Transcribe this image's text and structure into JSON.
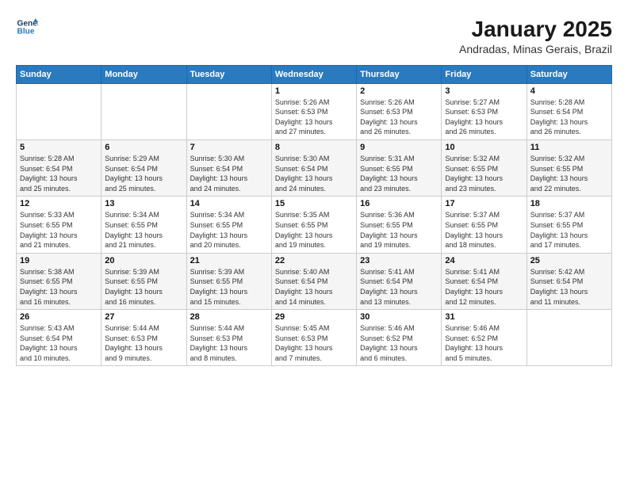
{
  "logo": {
    "line1": "General",
    "line2": "Blue"
  },
  "title": "January 2025",
  "subtitle": "Andradas, Minas Gerais, Brazil",
  "weekdays": [
    "Sunday",
    "Monday",
    "Tuesday",
    "Wednesday",
    "Thursday",
    "Friday",
    "Saturday"
  ],
  "weeks": [
    [
      {
        "day": "",
        "info": ""
      },
      {
        "day": "",
        "info": ""
      },
      {
        "day": "",
        "info": ""
      },
      {
        "day": "1",
        "info": "Sunrise: 5:26 AM\nSunset: 6:53 PM\nDaylight: 13 hours\nand 27 minutes."
      },
      {
        "day": "2",
        "info": "Sunrise: 5:26 AM\nSunset: 6:53 PM\nDaylight: 13 hours\nand 26 minutes."
      },
      {
        "day": "3",
        "info": "Sunrise: 5:27 AM\nSunset: 6:53 PM\nDaylight: 13 hours\nand 26 minutes."
      },
      {
        "day": "4",
        "info": "Sunrise: 5:28 AM\nSunset: 6:54 PM\nDaylight: 13 hours\nand 26 minutes."
      }
    ],
    [
      {
        "day": "5",
        "info": "Sunrise: 5:28 AM\nSunset: 6:54 PM\nDaylight: 13 hours\nand 25 minutes."
      },
      {
        "day": "6",
        "info": "Sunrise: 5:29 AM\nSunset: 6:54 PM\nDaylight: 13 hours\nand 25 minutes."
      },
      {
        "day": "7",
        "info": "Sunrise: 5:30 AM\nSunset: 6:54 PM\nDaylight: 13 hours\nand 24 minutes."
      },
      {
        "day": "8",
        "info": "Sunrise: 5:30 AM\nSunset: 6:54 PM\nDaylight: 13 hours\nand 24 minutes."
      },
      {
        "day": "9",
        "info": "Sunrise: 5:31 AM\nSunset: 6:55 PM\nDaylight: 13 hours\nand 23 minutes."
      },
      {
        "day": "10",
        "info": "Sunrise: 5:32 AM\nSunset: 6:55 PM\nDaylight: 13 hours\nand 23 minutes."
      },
      {
        "day": "11",
        "info": "Sunrise: 5:32 AM\nSunset: 6:55 PM\nDaylight: 13 hours\nand 22 minutes."
      }
    ],
    [
      {
        "day": "12",
        "info": "Sunrise: 5:33 AM\nSunset: 6:55 PM\nDaylight: 13 hours\nand 21 minutes."
      },
      {
        "day": "13",
        "info": "Sunrise: 5:34 AM\nSunset: 6:55 PM\nDaylight: 13 hours\nand 21 minutes."
      },
      {
        "day": "14",
        "info": "Sunrise: 5:34 AM\nSunset: 6:55 PM\nDaylight: 13 hours\nand 20 minutes."
      },
      {
        "day": "15",
        "info": "Sunrise: 5:35 AM\nSunset: 6:55 PM\nDaylight: 13 hours\nand 19 minutes."
      },
      {
        "day": "16",
        "info": "Sunrise: 5:36 AM\nSunset: 6:55 PM\nDaylight: 13 hours\nand 19 minutes."
      },
      {
        "day": "17",
        "info": "Sunrise: 5:37 AM\nSunset: 6:55 PM\nDaylight: 13 hours\nand 18 minutes."
      },
      {
        "day": "18",
        "info": "Sunrise: 5:37 AM\nSunset: 6:55 PM\nDaylight: 13 hours\nand 17 minutes."
      }
    ],
    [
      {
        "day": "19",
        "info": "Sunrise: 5:38 AM\nSunset: 6:55 PM\nDaylight: 13 hours\nand 16 minutes."
      },
      {
        "day": "20",
        "info": "Sunrise: 5:39 AM\nSunset: 6:55 PM\nDaylight: 13 hours\nand 16 minutes."
      },
      {
        "day": "21",
        "info": "Sunrise: 5:39 AM\nSunset: 6:55 PM\nDaylight: 13 hours\nand 15 minutes."
      },
      {
        "day": "22",
        "info": "Sunrise: 5:40 AM\nSunset: 6:54 PM\nDaylight: 13 hours\nand 14 minutes."
      },
      {
        "day": "23",
        "info": "Sunrise: 5:41 AM\nSunset: 6:54 PM\nDaylight: 13 hours\nand 13 minutes."
      },
      {
        "day": "24",
        "info": "Sunrise: 5:41 AM\nSunset: 6:54 PM\nDaylight: 13 hours\nand 12 minutes."
      },
      {
        "day": "25",
        "info": "Sunrise: 5:42 AM\nSunset: 6:54 PM\nDaylight: 13 hours\nand 11 minutes."
      }
    ],
    [
      {
        "day": "26",
        "info": "Sunrise: 5:43 AM\nSunset: 6:54 PM\nDaylight: 13 hours\nand 10 minutes."
      },
      {
        "day": "27",
        "info": "Sunrise: 5:44 AM\nSunset: 6:53 PM\nDaylight: 13 hours\nand 9 minutes."
      },
      {
        "day": "28",
        "info": "Sunrise: 5:44 AM\nSunset: 6:53 PM\nDaylight: 13 hours\nand 8 minutes."
      },
      {
        "day": "29",
        "info": "Sunrise: 5:45 AM\nSunset: 6:53 PM\nDaylight: 13 hours\nand 7 minutes."
      },
      {
        "day": "30",
        "info": "Sunrise: 5:46 AM\nSunset: 6:52 PM\nDaylight: 13 hours\nand 6 minutes."
      },
      {
        "day": "31",
        "info": "Sunrise: 5:46 AM\nSunset: 6:52 PM\nDaylight: 13 hours\nand 5 minutes."
      },
      {
        "day": "",
        "info": ""
      }
    ]
  ]
}
